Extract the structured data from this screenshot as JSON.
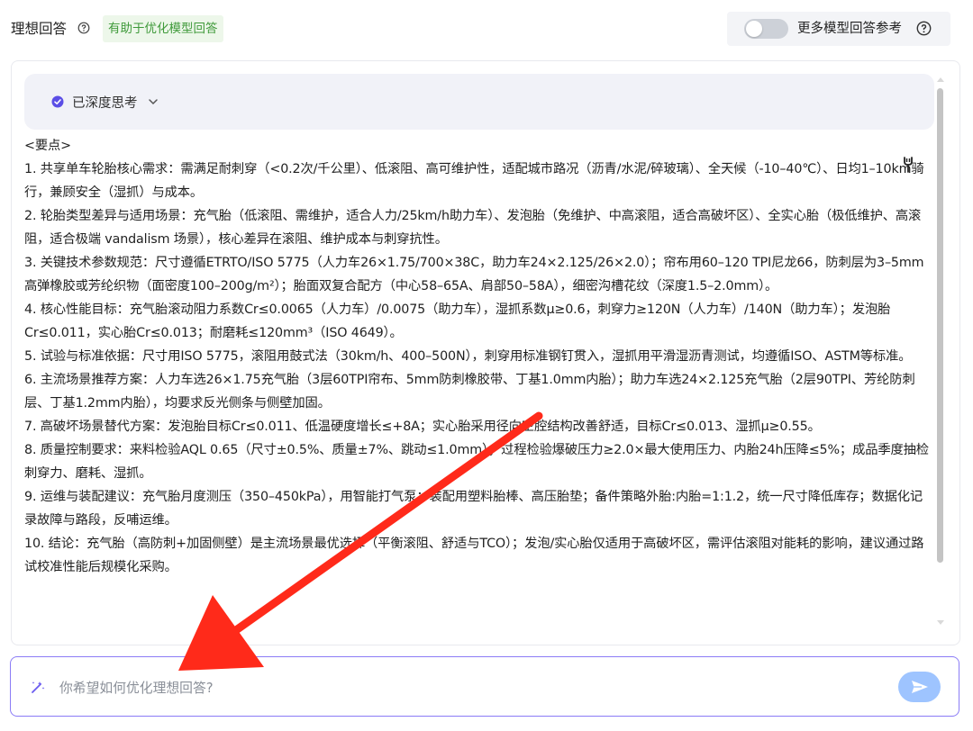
{
  "header": {
    "title": "理想回答",
    "badge": "有助于优化模型回答",
    "compare_label": "更多模型回答参考",
    "compare_toggle_on": false
  },
  "thinking": {
    "label": "已深度思考"
  },
  "answer": {
    "lines": [
      "<要点>",
      "1. 共享单车轮胎核心需求：需满足耐刺穿（<0.2次/千公里）、低滚阻、高可维护性，适配城市路况（沥青/水泥/碎玻璃）、全天候（-10–40℃）、日均1–10km骑行，兼顾安全（湿抓）与成本。",
      "2. 轮胎类型差异与适用场景：充气胎（低滚阻、需维护，适合人力/25km/h助力车）、发泡胎（免维护、中高滚阻，适合高破坏区）、全实心胎（极低维护、高滚阻，适合极端 vandalism 场景），核心差异在滚阻、维护成本与刺穿抗性。",
      "3. 关键技术参数规范：尺寸遵循ETRTO/ISO 5775（人力车26×1.75/700×38C，助力车24×2.125/26×2.0）；帘布用60–120 TPI尼龙66，防刺层为3–5mm高弹橡胶或芳纶织物（面密度100–200g/m²）；胎面双复合配方（中心58–65A、肩部50–58A），细密沟槽花纹（深度1.5–2.0mm）。",
      "4. 核心性能目标：充气胎滚动阻力系数Cr≤0.0065（人力车）/0.0075（助力车），湿抓系数μ≥0.6，刺穿力≥120N（人力车）/140N（助力车）；发泡胎Cr≤0.011，实心胎Cr≤0.013；耐磨耗≤120mm³（ISO 4649）。",
      "5. 试验与标准依据：尺寸用ISO 5775，滚阻用鼓式法（30km/h、400–500N），刺穿用标准钢钉贯入，湿抓用平滑湿沥青测试，均遵循ISO、ASTM等标准。",
      "6. 主流场景推荐方案：人力车选26×1.75充气胎（3层60TPI帘布、5mm防刺橡胶带、丁基1.0mm内胎）；助力车选24×2.125充气胎（2层90TPI、芳纶防刺层、丁基1.2mm内胎），均要求反光侧条与侧壁加固。",
      "7. 高破坏场景替代方案：发泡胎目标Cr≤0.011、低温硬度增长≤+8A；实心胎采用径向空腔结构改善舒适，目标Cr≤0.013、湿抓μ≥0.55。",
      "8. 质量控制要求：来料检验AQL 0.65（尺寸±0.5%、质量±7%、跳动≤1.0mm）；过程检验爆破压力≥2.0×最大使用压力、内胎24h压降≤5%；成品季度抽检刺穿力、磨耗、湿抓。",
      "9. 运维与装配建议：充气胎月度测压（350–450kPa），用智能打气泵；装配用塑料胎棒、高压胎垫；备件策略外胎:内胎=1:1.2，统一尺寸降低库存；数据化记录故障与路段，反哺运维。",
      "10. 结论：充气胎（高防刺+加固侧壁）是主流场景最优选择（平衡滚阻、舒适与TCO）；发泡/实心胎仅适用于高破坏区，需评估滚阻对能耗的影响，建议通过路试校准性能后规模化采购。"
    ]
  },
  "input": {
    "placeholder": "你希望如何优化理想回答?",
    "value": ""
  },
  "colors": {
    "badge_text": "#3f9a3a",
    "accent": "#8b7cf6",
    "send_button": "#9ec4ff",
    "arrow": "#ff2a1a"
  }
}
